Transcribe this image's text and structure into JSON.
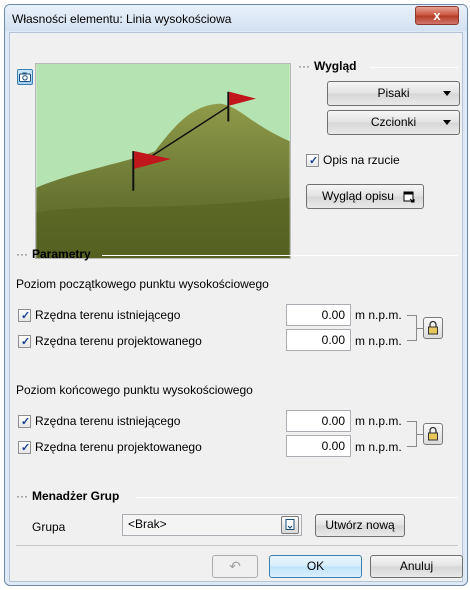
{
  "window": {
    "title": "Własności elementu: Linia wysokościowa",
    "close_glyph": "x"
  },
  "appearance": {
    "heading": "Wygląd",
    "pens_label": "Pisaki",
    "fonts_label": "Czcionki",
    "plan_label_checkbox": {
      "label": "Opis na rzucie",
      "checked": true
    },
    "label_appearance_button": "Wygląd opisu"
  },
  "parameters": {
    "heading": "Parametry",
    "start_group": {
      "title": "Poziom początkowego punktu wysokościowego",
      "rows": [
        {
          "label": "Rzędna terenu istniejącego",
          "checked": true,
          "value": "0.00",
          "unit": "m n.p.m."
        },
        {
          "label": "Rzędna terenu projektowanego",
          "checked": true,
          "value": "0.00",
          "unit": "m n.p.m."
        }
      ]
    },
    "end_group": {
      "title": "Poziom końcowego punktu wysokościowego",
      "rows": [
        {
          "label": "Rzędna terenu istniejącego",
          "checked": true,
          "value": "0.00",
          "unit": "m n.p.m."
        },
        {
          "label": "Rzędna terenu projektowanego",
          "checked": true,
          "value": "0.00",
          "unit": "m n.p.m."
        }
      ]
    }
  },
  "group_manager": {
    "heading": "Menadżer Grup",
    "group_label": "Grupa",
    "group_value": "<Brak>",
    "create_button": "Utwórz nową"
  },
  "footer": {
    "undo_glyph": "↶",
    "ok_label": "OK",
    "cancel_label": "Anuluj"
  },
  "colors": {
    "accent": "#3c7fb1",
    "sky": "#b6e3b2",
    "grass": "#6f7f35",
    "flag": "#c0161c"
  }
}
